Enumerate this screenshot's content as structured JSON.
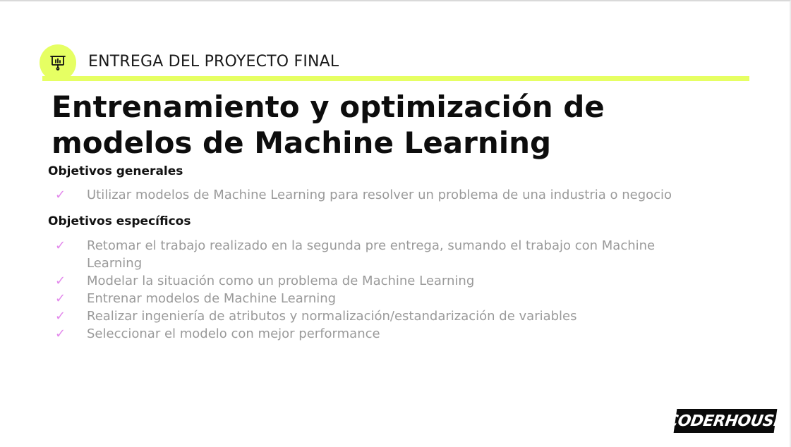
{
  "header": {
    "section_label": "ENTREGA DEL PROYECTO FINAL",
    "icon": "presentation-board-icon",
    "accent_color": "#e6ff63"
  },
  "title": {
    "line1": "Entrenamiento y optimización de",
    "line2": "modelos de Machine Learning"
  },
  "objectives": {
    "general": {
      "heading": "Objetivos generales",
      "items": [
        "Utilizar modelos de Machine Learning para resolver un problema de una industria o negocio"
      ]
    },
    "specific": {
      "heading": "Objetivos específicos",
      "items": [
        "Retomar el trabajo realizado en la segunda pre entrega, sumando el trabajo con Machine Learning",
        "Modelar la situación como un problema de Machine Learning",
        "Entrenar modelos de Machine Learning",
        "Realizar ingeniería de atributos y normalización/estandarización de variables",
        "Seleccionar el modelo con mejor performance"
      ]
    },
    "bullet_symbol": "✓",
    "bullet_color": "#e388ec"
  },
  "brand": {
    "logo_text": "CODERHOUSE"
  }
}
